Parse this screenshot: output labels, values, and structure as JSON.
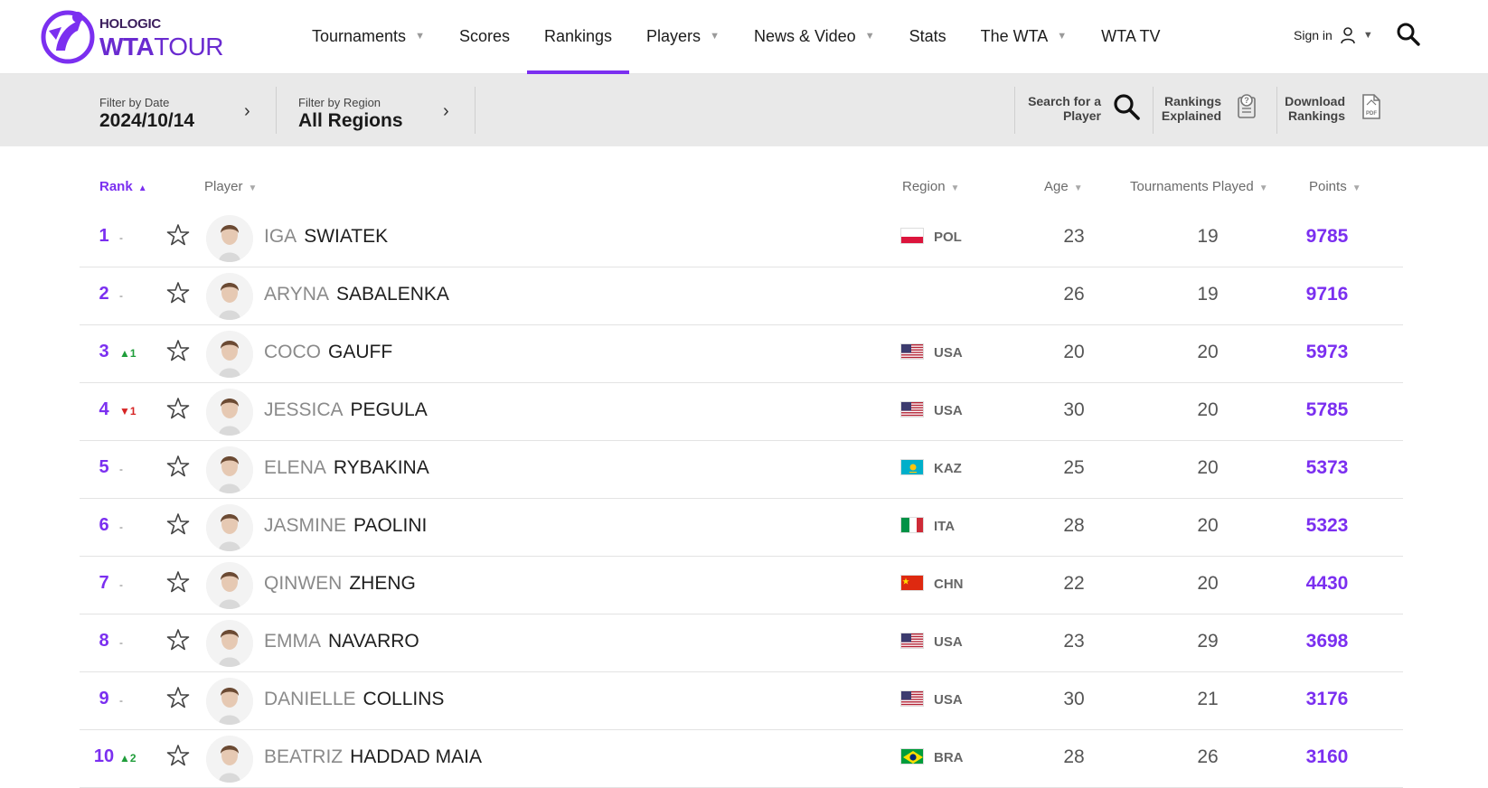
{
  "brand": {
    "sponsor": "HOLOGIC",
    "name_bold": "WTA",
    "name_light": "TOUR",
    "color": "#6a2bd0"
  },
  "nav": {
    "items": [
      {
        "label": "Tournaments",
        "dropdown": true,
        "active": false
      },
      {
        "label": "Scores",
        "dropdown": false,
        "active": false
      },
      {
        "label": "Rankings",
        "dropdown": false,
        "active": true
      },
      {
        "label": "Players",
        "dropdown": true,
        "active": false
      },
      {
        "label": "News & Video",
        "dropdown": true,
        "active": false
      },
      {
        "label": "Stats",
        "dropdown": false,
        "active": false
      },
      {
        "label": "The WTA",
        "dropdown": true,
        "active": false
      },
      {
        "label": "WTA TV",
        "dropdown": false,
        "active": false
      }
    ],
    "signin_label": "Sign in",
    "accent": "#7b2ff0"
  },
  "filters": {
    "date_label": "Filter by Date",
    "date_value": "2024/10/14",
    "region_label": "Filter by Region",
    "region_value": "All Regions"
  },
  "tools": {
    "search_line1": "Search for a",
    "search_line2": "Player",
    "explained_line1": "Rankings",
    "explained_line2": "Explained",
    "download_line1": "Download",
    "download_line2": "Rankings",
    "pdf_icon_text": "PDF"
  },
  "table": {
    "headers": {
      "rank": "Rank",
      "player": "Player",
      "region": "Region",
      "age": "Age",
      "tournaments": "Tournaments Played",
      "points": "Points"
    },
    "rows": [
      {
        "rank": "1",
        "move": "-",
        "move_dir": "none",
        "first": "IGA",
        "last": "SWIATEK",
        "flag": "pol",
        "country": "POL",
        "age": "23",
        "played": "19",
        "points": "9785"
      },
      {
        "rank": "2",
        "move": "-",
        "move_dir": "none",
        "first": "ARYNA",
        "last": "SABALENKA",
        "flag": "none",
        "country": "",
        "age": "26",
        "played": "19",
        "points": "9716"
      },
      {
        "rank": "3",
        "move": "▲1",
        "move_dir": "up",
        "first": "COCO",
        "last": "GAUFF",
        "flag": "usa",
        "country": "USA",
        "age": "20",
        "played": "20",
        "points": "5973"
      },
      {
        "rank": "4",
        "move": "▼1",
        "move_dir": "down",
        "first": "JESSICA",
        "last": "PEGULA",
        "flag": "usa",
        "country": "USA",
        "age": "30",
        "played": "20",
        "points": "5785"
      },
      {
        "rank": "5",
        "move": "-",
        "move_dir": "none",
        "first": "ELENA",
        "last": "RYBAKINA",
        "flag": "kaz",
        "country": "KAZ",
        "age": "25",
        "played": "20",
        "points": "5373"
      },
      {
        "rank": "6",
        "move": "-",
        "move_dir": "none",
        "first": "JASMINE",
        "last": "PAOLINI",
        "flag": "ita",
        "country": "ITA",
        "age": "28",
        "played": "20",
        "points": "5323"
      },
      {
        "rank": "7",
        "move": "-",
        "move_dir": "none",
        "first": "QINWEN",
        "last": "ZHENG",
        "flag": "chn",
        "country": "CHN",
        "age": "22",
        "played": "20",
        "points": "4430"
      },
      {
        "rank": "8",
        "move": "-",
        "move_dir": "none",
        "first": "EMMA",
        "last": "NAVARRO",
        "flag": "usa",
        "country": "USA",
        "age": "23",
        "played": "29",
        "points": "3698"
      },
      {
        "rank": "9",
        "move": "-",
        "move_dir": "none",
        "first": "DANIELLE",
        "last": "COLLINS",
        "flag": "usa",
        "country": "USA",
        "age": "30",
        "played": "21",
        "points": "3176"
      },
      {
        "rank": "10",
        "move": "▲2",
        "move_dir": "up",
        "first": "BEATRIZ",
        "last": "HADDAD MAIA",
        "flag": "bra",
        "country": "BRA",
        "age": "28",
        "played": "26",
        "points": "3160"
      }
    ]
  }
}
